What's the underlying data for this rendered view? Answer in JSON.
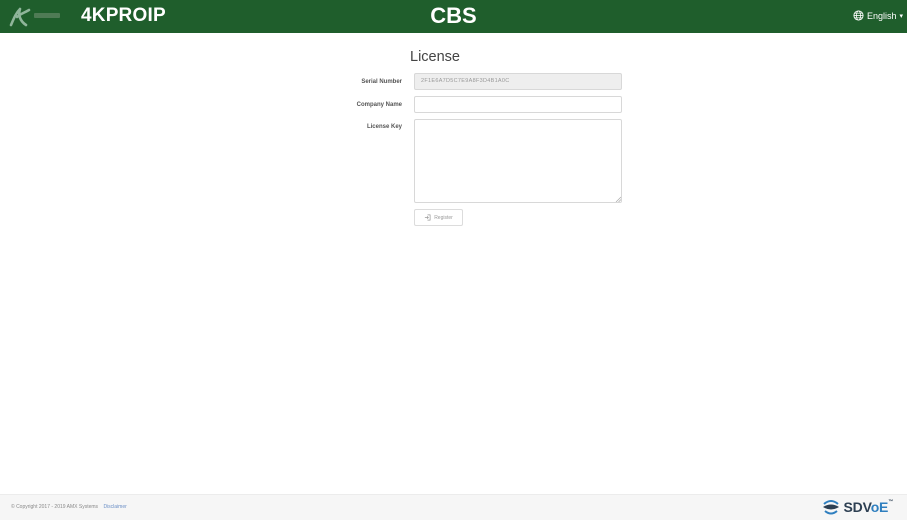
{
  "header": {
    "brand": "4KPROIP",
    "app_title": "CBS",
    "language": "English",
    "colors": {
      "bar": "#1f5e2c",
      "text": "#ffffff"
    },
    "icons": {
      "logo": "aims-logo-icon",
      "language": "globe-icon",
      "dropdown": "caret-down-icon"
    }
  },
  "form": {
    "title": "License",
    "fields": {
      "serial": {
        "label": "Serial Number",
        "value": "2F1E6A7D5C7E9A8F3D4B1A0C"
      },
      "company": {
        "label": "Company Name",
        "value": ""
      },
      "key": {
        "label": "License Key",
        "value": ""
      }
    },
    "register_label": "Register"
  },
  "footer": {
    "copyright": "© Copyright 2017 - 2019 AMX Systems",
    "disclaimer": "Disclaimer",
    "sdvoe_sd": "SDV",
    "sdvoe_oe": "oE",
    "trademark": "™"
  }
}
